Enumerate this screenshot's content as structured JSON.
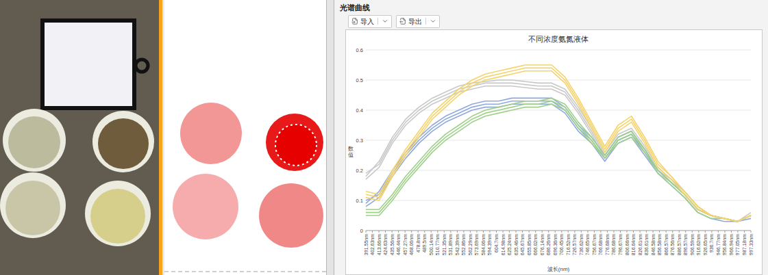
{
  "mask_panel": {
    "regions": [
      {
        "color": "#f28b8b"
      },
      {
        "color": "#e60000"
      },
      {
        "color": "#f5a3a3"
      },
      {
        "color": "#f07b7b"
      }
    ]
  },
  "spectrum_panel": {
    "title": "光谱曲线",
    "toolbar": [
      {
        "label": "导入"
      },
      {
        "label": "导出"
      }
    ],
    "chart": {
      "title": "不同浓度氨氮液体",
      "y_axis": {
        "label": "数值",
        "ticks": [
          "0",
          "0.1",
          "0.2",
          "0.3",
          "0.4",
          "0.5",
          "0.6"
        ]
      },
      "x_axis": {
        "label": "波长(nm)",
        "ticks": [
          "391.55nm",
          "402.63nm",
          "413.66nm",
          "424.63nm",
          "435.56nm",
          "446.44nm",
          "457.27nm",
          "468.06nm",
          "478.8nm",
          "489.5nm",
          "500.14nm",
          "510.77nm",
          "521.35nm",
          "531.89nm",
          "542.39nm",
          "552.86nm",
          "562.29nm",
          "573.69nm",
          "584.06nm",
          "594.39nm",
          "604.7nm",
          "614.98nm",
          "625.24nm",
          "635.46nm",
          "645.67nm",
          "655.85nm",
          "666.02nm",
          "676.14nm",
          "686.26nm",
          "696.36nm",
          "706.45nm",
          "716.52nm",
          "726.57nm",
          "736.62nm",
          "746.65nm",
          "756.67nm",
          "766.68nm",
          "776.68nm",
          "786.68nm",
          "796.67nm",
          "806.66nm",
          "816.64nm",
          "826.61nm",
          "836.61nm",
          "846.58nm",
          "856.58nm",
          "866.57nm",
          "876.56nm",
          "886.57nm",
          "896.57nm",
          "906.59nm",
          "916.62nm",
          "926.65nm",
          "936.7nm",
          "946.77nm",
          "956.84nm",
          "966.94nm",
          "977.05nm",
          "987.18nm",
          "997.33nm"
        ]
      },
      "series": [
        {
          "color": "#c8c8c8",
          "values": [
            0.19,
            0.22,
            0.3,
            0.36,
            0.4,
            0.43,
            0.45,
            0.47,
            0.48,
            0.49,
            0.49,
            0.49,
            0.485,
            0.48,
            0.48,
            0.46,
            0.4,
            0.33,
            0.25,
            0.31,
            0.33,
            0.27,
            0.2,
            0.17,
            0.13,
            0.08,
            0.05,
            0.04,
            0.03,
            0.05
          ]
        },
        {
          "color": "#c8c8c8",
          "values": [
            0.18,
            0.23,
            0.31,
            0.37,
            0.41,
            0.44,
            0.46,
            0.48,
            0.49,
            0.495,
            0.5,
            0.5,
            0.495,
            0.49,
            0.49,
            0.47,
            0.41,
            0.34,
            0.26,
            0.32,
            0.34,
            0.28,
            0.21,
            0.17,
            0.13,
            0.08,
            0.05,
            0.04,
            0.03,
            0.06
          ]
        },
        {
          "color": "#c8c8c8",
          "values": [
            0.17,
            0.21,
            0.29,
            0.35,
            0.39,
            0.42,
            0.44,
            0.46,
            0.47,
            0.48,
            0.48,
            0.48,
            0.475,
            0.47,
            0.47,
            0.45,
            0.39,
            0.32,
            0.24,
            0.3,
            0.32,
            0.26,
            0.19,
            0.16,
            0.12,
            0.07,
            0.05,
            0.04,
            0.03,
            0.05
          ]
        },
        {
          "color": "#8fa9dc",
          "values": [
            0.1,
            0.12,
            0.19,
            0.25,
            0.3,
            0.34,
            0.37,
            0.39,
            0.41,
            0.42,
            0.42,
            0.43,
            0.43,
            0.43,
            0.43,
            0.4,
            0.34,
            0.3,
            0.24,
            0.3,
            0.32,
            0.26,
            0.2,
            0.16,
            0.12,
            0.07,
            0.05,
            0.04,
            0.03,
            0.05
          ]
        },
        {
          "color": "#8fa9dc",
          "values": [
            0.09,
            0.13,
            0.2,
            0.26,
            0.31,
            0.35,
            0.38,
            0.4,
            0.42,
            0.43,
            0.43,
            0.44,
            0.44,
            0.44,
            0.44,
            0.41,
            0.35,
            0.31,
            0.25,
            0.31,
            0.33,
            0.27,
            0.2,
            0.16,
            0.12,
            0.07,
            0.05,
            0.04,
            0.03,
            0.05
          ]
        },
        {
          "color": "#8fa9dc",
          "values": [
            0.08,
            0.11,
            0.18,
            0.24,
            0.29,
            0.33,
            0.36,
            0.38,
            0.4,
            0.41,
            0.41,
            0.42,
            0.42,
            0.42,
            0.42,
            0.39,
            0.33,
            0.29,
            0.23,
            0.29,
            0.31,
            0.25,
            0.19,
            0.15,
            0.11,
            0.06,
            0.04,
            0.03,
            0.03,
            0.04
          ]
        },
        {
          "color": "#9fd089",
          "values": [
            0.06,
            0.06,
            0.11,
            0.17,
            0.22,
            0.27,
            0.31,
            0.34,
            0.37,
            0.39,
            0.4,
            0.41,
            0.42,
            0.42,
            0.43,
            0.41,
            0.35,
            0.3,
            0.24,
            0.3,
            0.32,
            0.27,
            0.2,
            0.16,
            0.12,
            0.07,
            0.05,
            0.04,
            0.03,
            0.05
          ]
        },
        {
          "color": "#9fd089",
          "values": [
            0.07,
            0.07,
            0.12,
            0.18,
            0.23,
            0.28,
            0.32,
            0.35,
            0.38,
            0.4,
            0.41,
            0.42,
            0.43,
            0.43,
            0.44,
            0.42,
            0.36,
            0.31,
            0.25,
            0.31,
            0.33,
            0.27,
            0.2,
            0.16,
            0.12,
            0.07,
            0.05,
            0.04,
            0.03,
            0.05
          ]
        },
        {
          "color": "#9fd089",
          "values": [
            0.05,
            0.05,
            0.1,
            0.16,
            0.21,
            0.26,
            0.3,
            0.33,
            0.36,
            0.38,
            0.39,
            0.4,
            0.41,
            0.41,
            0.42,
            0.4,
            0.34,
            0.29,
            0.24,
            0.29,
            0.31,
            0.26,
            0.19,
            0.15,
            0.11,
            0.06,
            0.04,
            0.04,
            0.03,
            0.05
          ]
        },
        {
          "color": "#f5d36b",
          "values": [
            0.12,
            0.11,
            0.19,
            0.26,
            0.32,
            0.38,
            0.42,
            0.46,
            0.49,
            0.51,
            0.52,
            0.53,
            0.54,
            0.54,
            0.54,
            0.5,
            0.43,
            0.35,
            0.27,
            0.34,
            0.37,
            0.3,
            0.22,
            0.18,
            0.13,
            0.08,
            0.05,
            0.04,
            0.03,
            0.05
          ]
        },
        {
          "color": "#f5d36b",
          "values": [
            0.13,
            0.12,
            0.2,
            0.27,
            0.33,
            0.39,
            0.43,
            0.47,
            0.5,
            0.52,
            0.53,
            0.54,
            0.55,
            0.55,
            0.55,
            0.51,
            0.44,
            0.36,
            0.28,
            0.35,
            0.38,
            0.31,
            0.23,
            0.18,
            0.13,
            0.08,
            0.05,
            0.04,
            0.03,
            0.05
          ]
        },
        {
          "color": "#f5d36b",
          "values": [
            0.11,
            0.1,
            0.18,
            0.25,
            0.31,
            0.37,
            0.41,
            0.45,
            0.48,
            0.5,
            0.51,
            0.52,
            0.53,
            0.53,
            0.53,
            0.49,
            0.42,
            0.34,
            0.26,
            0.33,
            0.36,
            0.29,
            0.21,
            0.17,
            0.12,
            0.07,
            0.05,
            0.04,
            0.03,
            0.05
          ]
        }
      ]
    }
  }
}
